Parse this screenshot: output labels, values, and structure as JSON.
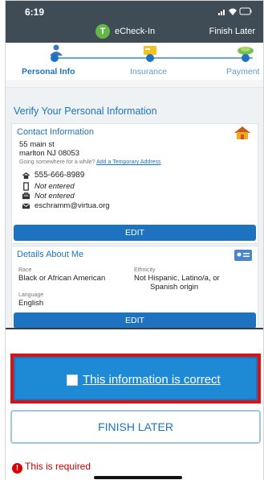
{
  "status_bar": {
    "time": "6:19"
  },
  "header": {
    "badge": "T",
    "title": "eCheck-In",
    "finish_later": "Finish Later"
  },
  "stepper": {
    "steps": [
      {
        "label": "Personal Info",
        "icon": "person-icon"
      },
      {
        "label": "Insurance",
        "icon": "insurance-card-icon"
      },
      {
        "label": "Payment",
        "icon": "money-icon"
      }
    ]
  },
  "page": {
    "title": "Verify Your Personal Information"
  },
  "contact": {
    "title": "Contact Information",
    "icon": "home-icon",
    "address_line1": "55 main st",
    "address_line2": "marlton NJ 08053",
    "temp_prompt": "Going somewhere for a while?",
    "temp_link": "Add a Temporary Address",
    "phone": "555-666-8989",
    "mobile": "Not entered",
    "fax": "Not entered",
    "email": "eschramm@virtua.org",
    "edit_label": "EDIT"
  },
  "details": {
    "title": "Details About Me",
    "icon": "id-card-icon",
    "race_label": "Race",
    "race_value": "Black or African American",
    "ethnicity_label": "Ethnicity",
    "ethnicity_value_line1": "Not Hispanic, Latino/a, or",
    "ethnicity_value_line2": "Spanish origin",
    "language_label": "Language",
    "language_value": "English",
    "edit_label": "EDIT"
  },
  "confirm": {
    "label": "This information is correct",
    "checked": false
  },
  "finish_button": {
    "label": "FINISH LATER"
  },
  "validation": {
    "message": "This is required"
  },
  "colors": {
    "primary": "#1e73c0",
    "header_bg": "#3f4c56",
    "error": "#e11010",
    "success": "#62b64a"
  }
}
